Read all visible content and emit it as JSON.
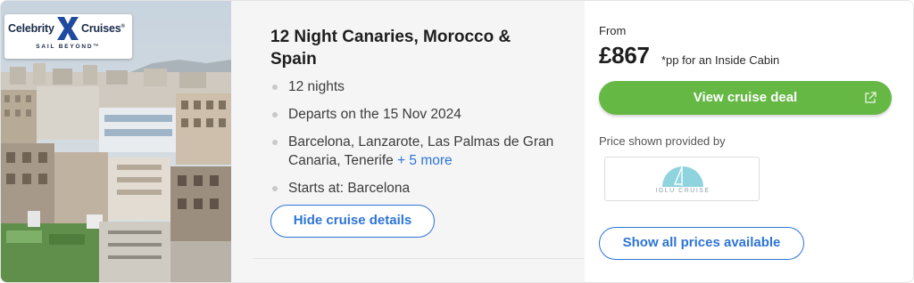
{
  "brand": {
    "name_left": "Celebrity",
    "name_right": "Cruises",
    "registered": "®",
    "tagline": "SAIL BEYOND™"
  },
  "cruise": {
    "title": "12 Night Canaries, Morocco & Spain",
    "facts": {
      "nights": "12 nights",
      "departs": "Departs on the 15 Nov 2024",
      "ports": "Barcelona, Lanzarote, Las Palmas de Gran Canaria, Tenerife",
      "more_ports": "+ 5 more",
      "starts": "Starts at: Barcelona"
    },
    "hide_details_label": "Hide cruise details"
  },
  "pricing": {
    "from_label": "From",
    "price": "£867",
    "per_person_note": "*pp for an Inside Cabin",
    "view_deal_label": "View cruise deal",
    "provided_by_label": "Price shown provided by",
    "provider_name": "IGLU CRUISE",
    "show_all_label": "Show all prices available"
  },
  "colors": {
    "accent_blue": "#2d74d6",
    "deal_green": "#66b845",
    "panel_bg": "#f5f5f6"
  },
  "icons": {
    "external_link": "external-link-icon",
    "bullet": "bullet-dot-icon"
  }
}
